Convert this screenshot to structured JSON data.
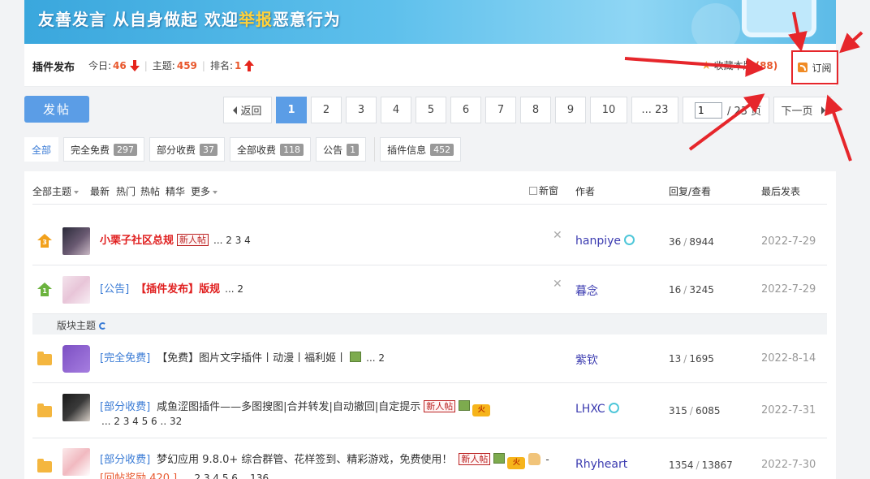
{
  "banner": {
    "text_part1": "友善发言 从自身做起 欢迎",
    "text_highlight": "举报",
    "text_part2": "恶意行为"
  },
  "forum": {
    "name": "插件发布",
    "today_label": "今日:",
    "today_value": "46",
    "topics_label": "主题:",
    "topics_value": "459",
    "rank_label": "排名:",
    "rank_value": "1",
    "favorite_label": "收藏本版",
    "favorite_count": "(88)",
    "subscribe_label": "订阅"
  },
  "toolbar": {
    "post_label": "发帖"
  },
  "pager": {
    "back_label": "返回",
    "pages": [
      "1",
      "2",
      "3",
      "4",
      "5",
      "6",
      "7",
      "8",
      "9",
      "10"
    ],
    "last_label": "... 23",
    "jump_value": "1",
    "total_label": "/ 23 页",
    "next_label": "下一页"
  },
  "filters": {
    "all": "全部",
    "items": [
      {
        "label": "完全免费",
        "count": "297"
      },
      {
        "label": "部分收费",
        "count": "37"
      },
      {
        "label": "全部收费",
        "count": "118"
      },
      {
        "label": "公告",
        "count": "1"
      }
    ],
    "info": {
      "label": "插件信息",
      "count": "452"
    }
  },
  "list_header": {
    "all_topics": "全部主题",
    "newest": "最新",
    "hot": "热门",
    "hot_posts": "热帖",
    "digest": "精华",
    "more": "更多",
    "new_window": "新窗",
    "author": "作者",
    "reply_view": "回复/查看",
    "last_post": "最后发表"
  },
  "section": {
    "label": "版块主题"
  },
  "threads": [
    {
      "tag": "",
      "title": "小栗子社区总规",
      "newbie": "新人帖",
      "pages": "... 2  3  4",
      "author": "hanpiye",
      "replies": "36",
      "views": "8944",
      "last": "2022-7-29"
    },
    {
      "tag": "[公告]",
      "title": "【插件发布】版规",
      "pages": "... 2",
      "author": "暮念",
      "replies": "16",
      "views": "3245",
      "last": "2022-7-29"
    },
    {
      "tag": "[完全免费]",
      "title": "【免费】图片文字插件丨动漫丨福利姬丨",
      "pages": "... 2",
      "author": "紫钦",
      "replies": "13",
      "views": "1695",
      "last": "2022-8-14"
    },
    {
      "tag": "[部分收费]",
      "title": "咸鱼涩图插件——多图搜图|合并转发|自动撤回|自定提示",
      "newbie": "新人帖",
      "pages": "... 2  3  4  5  6 .. 32",
      "author": "LHXC",
      "replies": "315",
      "views": "6085",
      "last": "2022-7-31"
    },
    {
      "tag": "[部分收费]",
      "title": "梦幻应用 9.8.0+ 综合群管、花样签到、精彩游戏，免费使用！",
      "newbie": "新人帖",
      "extra": "-",
      "reward": "[回帖奖励 420 ]",
      "pages": "... 2  3  4  5  6 .. 136",
      "author": "Rhyheart",
      "replies": "1354",
      "views": "13867",
      "last": "2022-7-30"
    }
  ],
  "colors": {
    "accent": "#5b9de6",
    "highlight_red": "#e02020",
    "annotation_red": "#e6262b"
  }
}
